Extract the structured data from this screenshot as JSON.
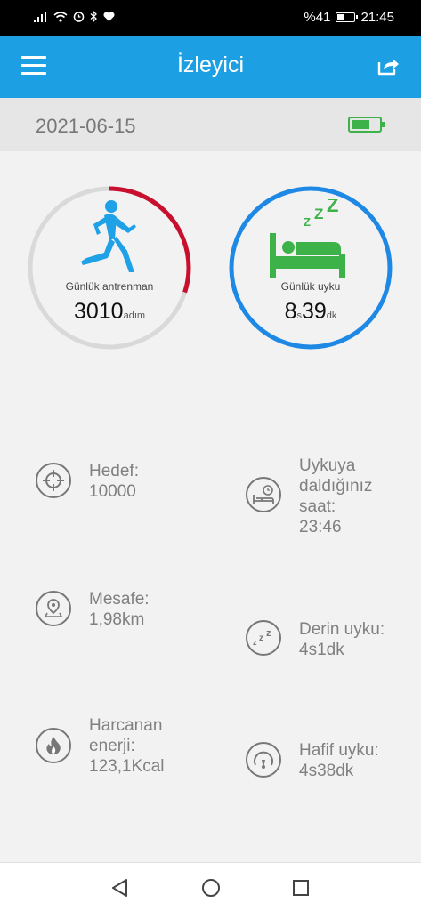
{
  "status_bar": {
    "battery_percent": "%41",
    "time": "21:45"
  },
  "app_bar": {
    "title": "İzleyici",
    "menu_icon": "hamburger-menu-icon",
    "share_icon": "share-icon"
  },
  "date_bar": {
    "date": "2021-06-15",
    "battery_icon": "device-battery-icon"
  },
  "activity_ring": {
    "label": "Günlük antrenman",
    "value": "3010",
    "unit": "adım",
    "progress_fraction": 0.3,
    "progress_color": "#c8102e",
    "track_color": "#d9d9d9",
    "icon": "running-person-icon",
    "icon_color": "#1ea1e6"
  },
  "sleep_ring": {
    "label": "Günlük uyku",
    "hours": "8",
    "hours_unit": "s",
    "minutes": "39",
    "minutes_unit": "dk",
    "ring_color": "#1e88e5",
    "icon": "sleeping-bed-icon",
    "icon_color": "#3db249"
  },
  "stats": {
    "goal": {
      "label": "Hedef:",
      "value": "10000",
      "icon": "target-icon"
    },
    "sleep_time": {
      "line1": "Uykuya",
      "line2": "daldığınız",
      "line3": "saat:",
      "value": "23:46",
      "icon": "bed-clock-icon"
    },
    "distance": {
      "label": "Mesafe:",
      "value": "1,98km",
      "icon": "map-pin-icon"
    },
    "deep_sleep": {
      "label": "Derin uyku:",
      "value": "4s1dk",
      "icon": "zzz-icon"
    },
    "energy": {
      "line1": "Harcanan",
      "line2": "enerji:",
      "value": "123,1Kcal",
      "icon": "flame-icon"
    },
    "light_sleep": {
      "label": "Hafif uyku:",
      "value": "4s38dk",
      "icon": "gauge-icon"
    }
  },
  "nav_bar": {
    "back_icon": "back-triangle-icon",
    "home_icon": "home-circle-icon",
    "recents_icon": "recents-square-icon"
  }
}
